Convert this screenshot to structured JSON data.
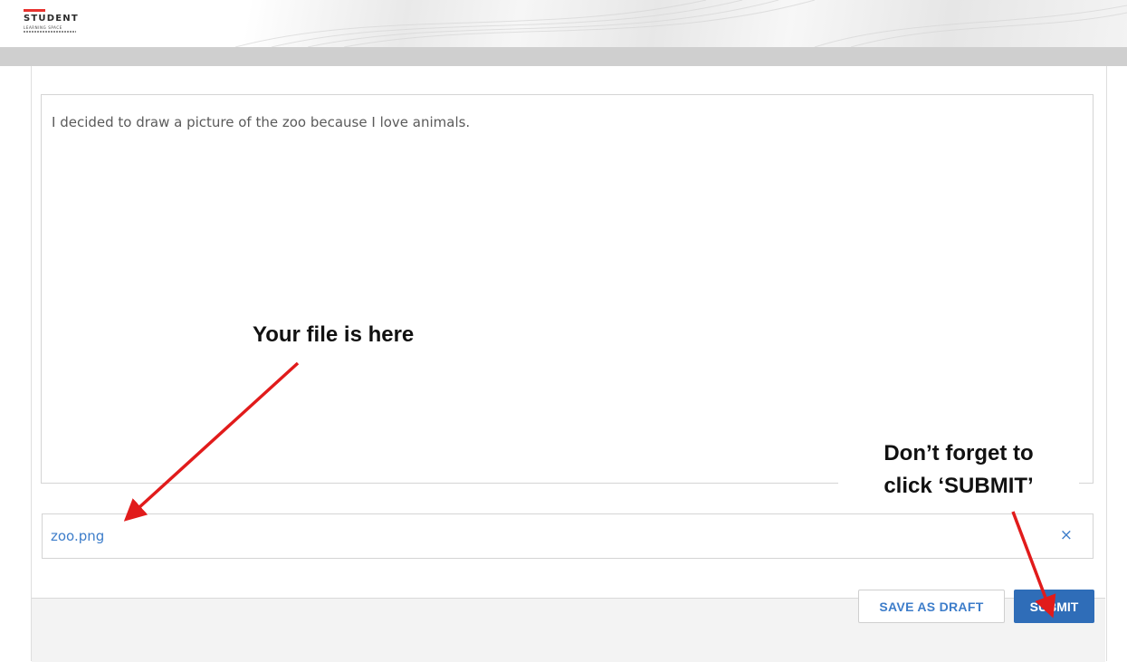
{
  "header": {
    "logo": {
      "word": "STUDENT",
      "subword": "LEARNING SPACE"
    }
  },
  "editor": {
    "text": "I decided to draw a picture of the zoo because I love animals."
  },
  "attachment": {
    "file_name": "zoo.png",
    "remove_icon": "×"
  },
  "footer": {
    "save_draft_label": "SAVE AS DRAFT",
    "submit_label": "SUBMIT"
  },
  "annotations": {
    "file_callout": "Your file is here",
    "submit_callout_line1": "Don’t forget to",
    "submit_callout_line2": "click ‘SUBMIT’",
    "arrow_color": "#e11b1b"
  },
  "colors": {
    "link_blue": "#3d7dca",
    "submit_blue": "#2f6db8",
    "logo_red": "#e8332f"
  }
}
